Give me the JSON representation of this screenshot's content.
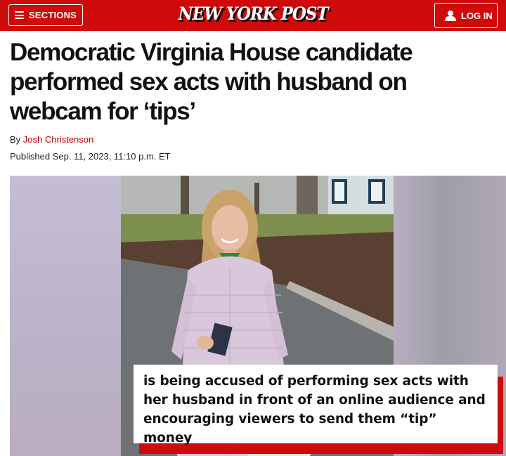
{
  "header": {
    "sections_label": "SECTIONS",
    "logo_text": "NEW YORK POST",
    "login_label": "LOG IN",
    "brand_color": "#cf0a0a"
  },
  "article": {
    "headline": "Democratic Virginia House candidate performed sex acts with husband on webcam for ‘tips’",
    "byline_prefix": "By",
    "author": "Josh Christenson",
    "published": "Published Sep. 11, 2023, 11:10 p.m. ET"
  },
  "media": {
    "caption": "is being accused of performing sex acts with her husband in front of an online audience and encouraging viewers to send them “tip” money"
  },
  "icons": [
    "hamburger-icon",
    "user-icon"
  ]
}
